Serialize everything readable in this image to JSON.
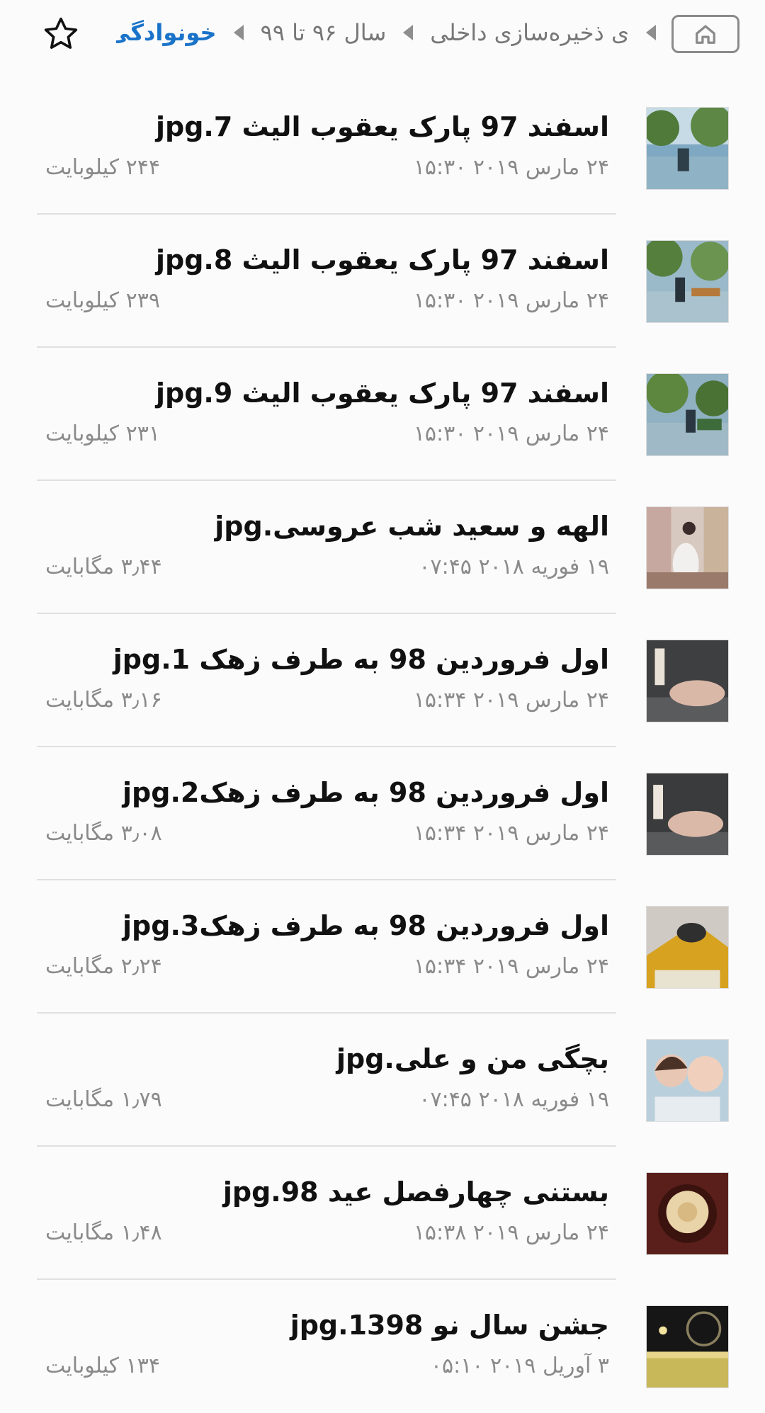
{
  "header": {
    "breadcrumbs": [
      "ی ذخیره‌سازی داخلی",
      "سال ۹۶ تا ۹۹",
      "خونوادگی"
    ]
  },
  "files": [
    {
      "name": "اسفند 97 پارک یعقوب الیث 7.jpg",
      "date": "۲۴ مارس ۲۰۱۹ ۱۵:۳۰",
      "size": "۲۴۴ کیلوبایت"
    },
    {
      "name": "اسفند 97 پارک یعقوب الیث 8.jpg",
      "date": "۲۴ مارس ۲۰۱۹ ۱۵:۳۰",
      "size": "۲۳۹ کیلوبایت"
    },
    {
      "name": "اسفند 97 پارک یعقوب الیث 9.jpg",
      "date": "۲۴ مارس ۲۰۱۹ ۱۵:۳۰",
      "size": "۲۳۱ کیلوبایت"
    },
    {
      "name": "الهه و سعید شب عروسی.jpg",
      "date": "۱۹ فوریه ۲۰۱۸ ۰۷:۴۵",
      "size": "۳٫۴۴ مگابایت"
    },
    {
      "name": "اول فروردین 98 به طرف زهک 1.jpg",
      "date": "۲۴ مارس ۲۰۱۹ ۱۵:۳۴",
      "size": "۳٫۱۶ مگابایت"
    },
    {
      "name": "اول فروردین 98 به طرف زهک2.jpg",
      "date": "۲۴ مارس ۲۰۱۹ ۱۵:۳۴",
      "size": "۳٫۰۸ مگابایت"
    },
    {
      "name": "اول فروردین 98 به طرف زهک3.jpg",
      "date": "۲۴ مارس ۲۰۱۹ ۱۵:۳۴",
      "size": "۲٫۲۴ مگابایت"
    },
    {
      "name": "بچگی من و علی.jpg",
      "date": "۱۹ فوریه ۲۰۱۸ ۰۷:۴۵",
      "size": "۱٫۷۹ مگابایت"
    },
    {
      "name": "بستنی چهارفصل عید 98.jpg",
      "date": "۲۴ مارس ۲۰۱۹ ۱۵:۳۸",
      "size": "۱٫۴۸ مگابایت"
    },
    {
      "name": "جشن سال نو 1398.jpg",
      "date": "۳ آوریل ۲۰۱۹ ۰۵:۱۰",
      "size": "۱۳۴ کیلوبایت"
    }
  ],
  "icons": {
    "favorite": "star-outline-icon",
    "home": "home-icon",
    "separator": "chevron-left-icon"
  },
  "colors": {
    "accent": "#1a73c9",
    "text": "#111111",
    "secondary": "#8a8a8a",
    "divider": "#e0e0e0"
  }
}
